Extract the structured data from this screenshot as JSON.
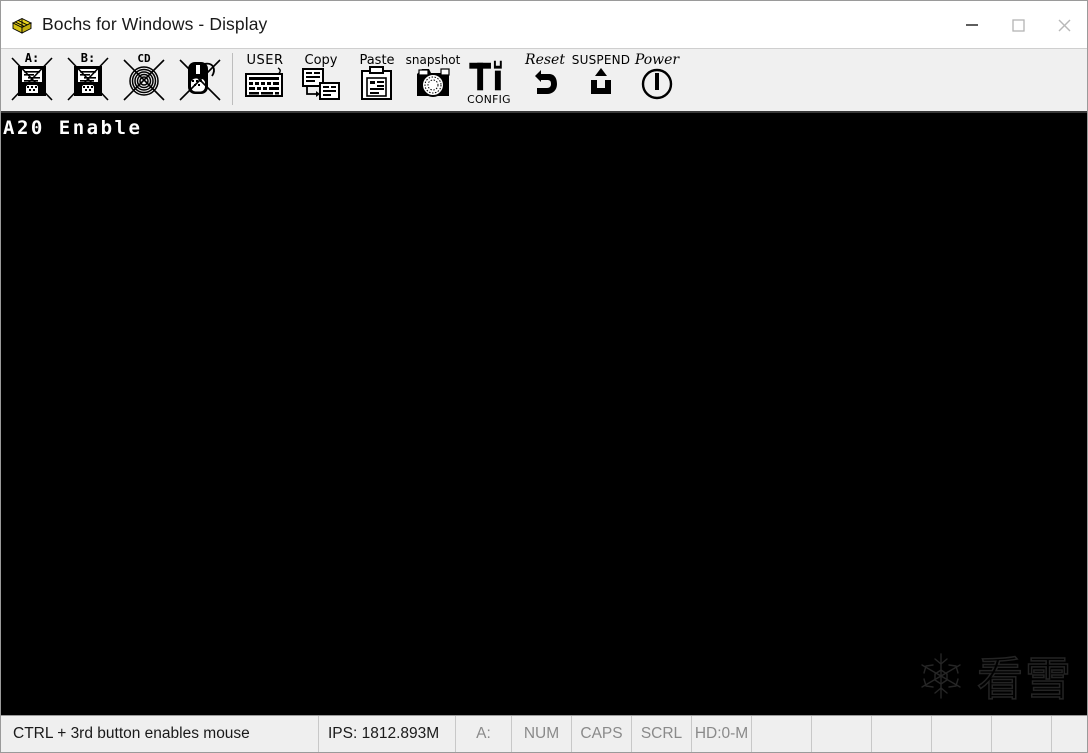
{
  "window": {
    "title": "Bochs for Windows - Display",
    "app_icon": "bochs-box-icon",
    "controls": {
      "minimize": "minimize-icon",
      "maximize": "maximize-icon",
      "close": "close-icon"
    }
  },
  "toolbar": {
    "items": [
      {
        "name": "floppy-a",
        "label": "A:",
        "icon": "floppy-disk-icon",
        "disabled": true
      },
      {
        "name": "floppy-b",
        "label": "B:",
        "icon": "floppy-disk-icon",
        "disabled": true
      },
      {
        "name": "cdrom",
        "label": "CD",
        "icon": "cdrom-icon",
        "disabled": true
      },
      {
        "name": "mouse",
        "label": "",
        "icon": "mouse-icon",
        "disabled": true
      },
      {
        "name": "user",
        "label": "USER",
        "icon": "keyboard-icon",
        "disabled": false
      },
      {
        "name": "copy",
        "label": "Copy",
        "icon": "copy-icon",
        "disabled": false
      },
      {
        "name": "paste",
        "label": "Paste",
        "icon": "clipboard-icon",
        "disabled": false
      },
      {
        "name": "snapshot",
        "label": "snapshot",
        "icon": "camera-icon",
        "disabled": false
      },
      {
        "name": "config",
        "label": "CONFIG",
        "icon": "tools-icon",
        "disabled": false
      },
      {
        "name": "reset",
        "label": "Reset",
        "icon": "reset-arrow-icon",
        "disabled": false
      },
      {
        "name": "suspend",
        "label": "SUSPEND",
        "icon": "suspend-arrow-icon",
        "disabled": false
      },
      {
        "name": "power",
        "label": "Power",
        "icon": "power-icon",
        "disabled": false
      }
    ]
  },
  "display": {
    "console_text": "A20 Enable",
    "background_color": "#000000",
    "text_color": "#ffffff",
    "watermark_text": "看雪",
    "watermark_icon": "snowflake-icon"
  },
  "statusbar": {
    "message": "CTRL + 3rd button enables mouse",
    "ips": "IPS: 1812.893M",
    "drive": "A:",
    "leds": [
      "NUM",
      "CAPS",
      "SCRL"
    ],
    "hd": "HD:0-M",
    "empty_cells": [
      "",
      "",
      "",
      "",
      "",
      ""
    ]
  },
  "colors": {
    "toolbar_bg": "#f0f0f0",
    "statusbar_bg": "#efefef",
    "titlebar_bg": "#ffffff",
    "icon_yellow": "#e8d41e",
    "display_bg": "#000000"
  }
}
